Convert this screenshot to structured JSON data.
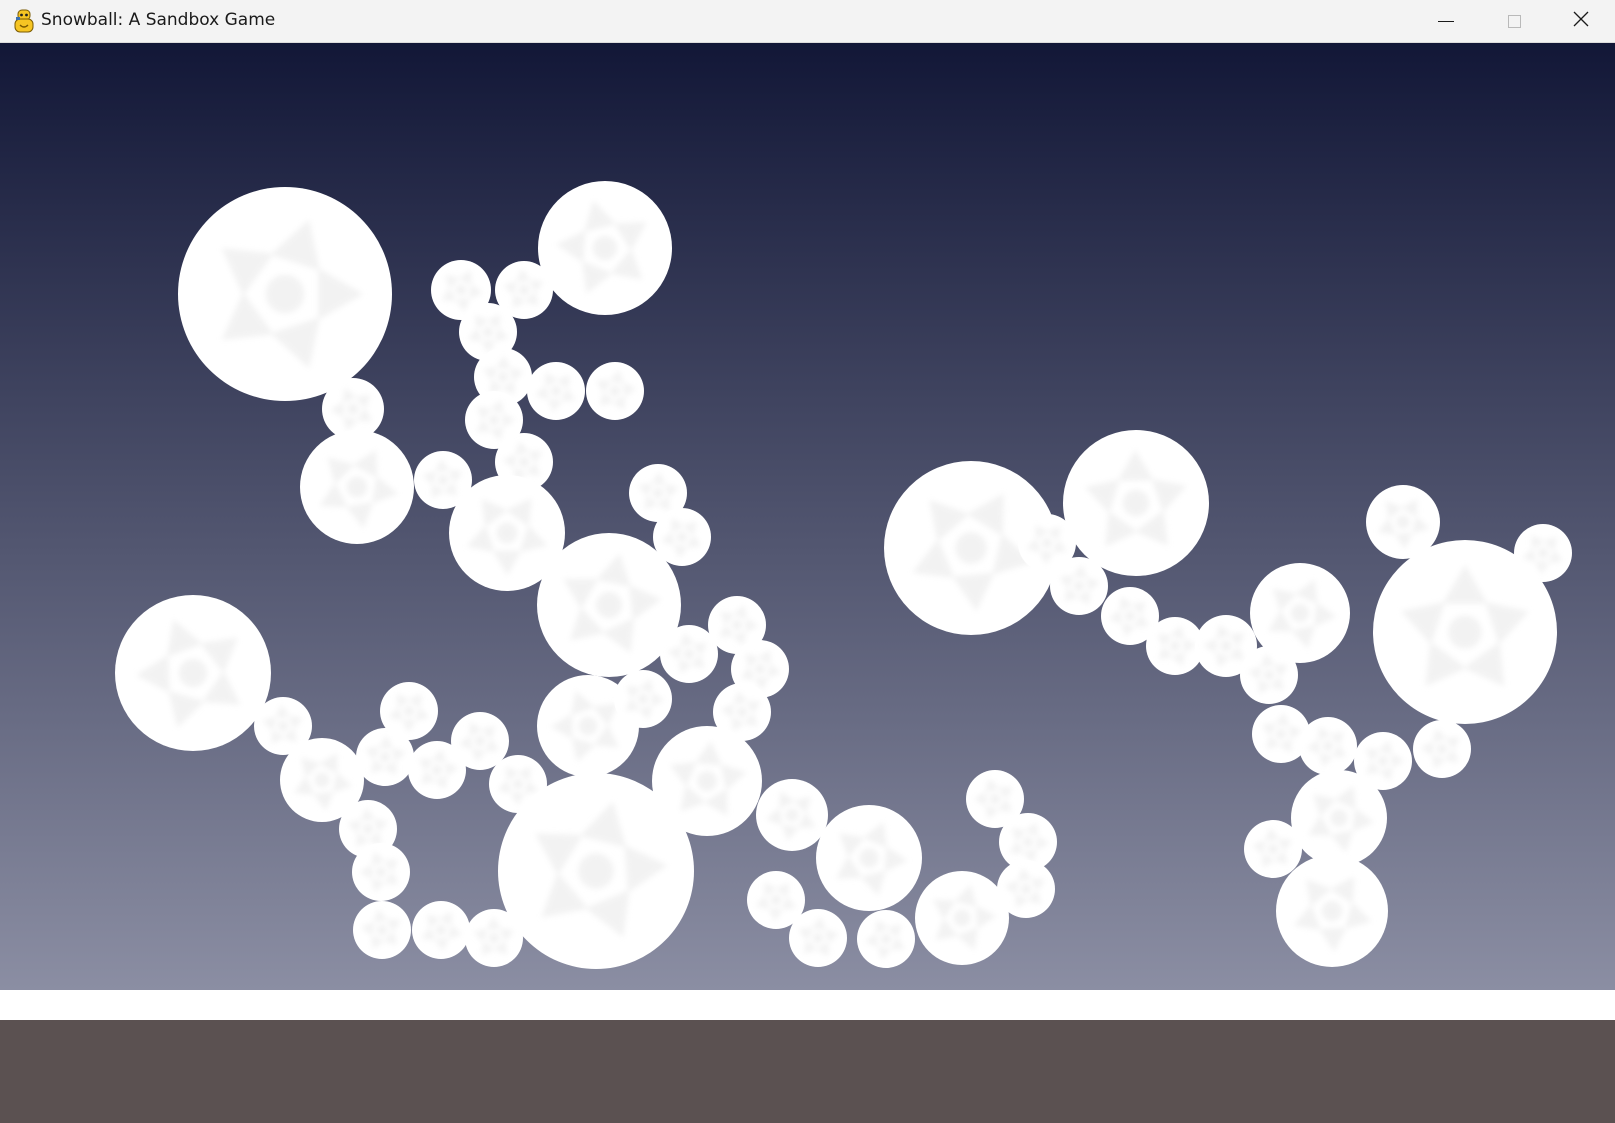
{
  "window": {
    "title": "Snowball: A Sandbox Game",
    "app_icon": "python-snake-icon",
    "controls": {
      "minimize_icon": "minimize-icon",
      "maximize_icon": "maximize-icon",
      "close_icon": "close-icon"
    }
  },
  "scene": {
    "sky_colors": {
      "top": "#121737",
      "bottom": "#8b8ea3"
    },
    "snow_line_color": "#ffffff",
    "ground_color": "#5b5151",
    "snowball_color": "#ffffff",
    "snowball_pattern_color": "#e8e8e8",
    "snowball_count": 79
  }
}
